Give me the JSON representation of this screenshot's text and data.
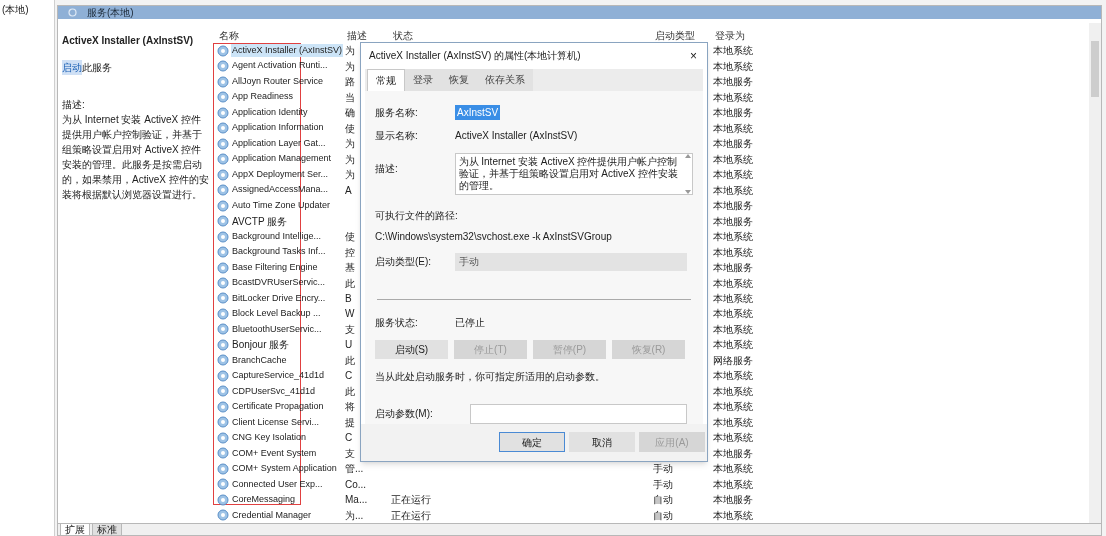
{
  "tree": {
    "label": "(本地)"
  },
  "header": {
    "title": "服务(本地)"
  },
  "detail": {
    "title": "ActiveX Installer (AxInstSV)",
    "action_link": "启动",
    "action_rest": "此服务",
    "description_label": "描述:",
    "description": "为从 Internet 安装 ActiveX 控件提供用户帐户控制验证，并基于组策略设置启用对 ActiveX 控件安装的管理。此服务是按需启动的，如果禁用，ActiveX 控件的安装将根据默认浏览器设置进行。"
  },
  "table": {
    "columns": [
      "名称",
      "描述",
      "状态",
      "启动类型",
      "登录为"
    ],
    "rows": [
      {
        "name": "ActiveX Installer (AxInstSV)",
        "description": "为",
        "logon": "本地系统",
        "selected": true
      },
      {
        "name": "Agent Activation Runti...",
        "description": "为",
        "logon": "本地系统",
        "selected": false
      },
      {
        "name": "AllJoyn Router Service",
        "description": "路",
        "logon": "本地服务",
        "selected": false
      },
      {
        "name": "App Readiness",
        "description": "当",
        "logon": "本地系统",
        "selected": false
      },
      {
        "name": "Application Identity",
        "description": "确",
        "logon": "本地服务",
        "selected": false
      },
      {
        "name": "Application Information",
        "description": "使",
        "logon": "本地系统",
        "selected": false
      },
      {
        "name": "Application Layer Gat...",
        "description": "为",
        "logon": "本地服务",
        "selected": false
      },
      {
        "name": "Application Management",
        "description": "为",
        "logon": "本地系统",
        "selected": false
      },
      {
        "name": "AppX Deployment Ser...",
        "description": "为",
        "logon": "本地系统",
        "selected": false
      },
      {
        "name": "AssignedAccessMana...",
        "description": "A",
        "logon": "本地系统",
        "selected": false
      },
      {
        "name": "Auto Time Zone Updater",
        "logon": "本地服务",
        "selected": false
      },
      {
        "name": "AVCTP 服务",
        "logon": "本地服务",
        "selected": false
      },
      {
        "name": "Background Intellige...",
        "description": "使",
        "logon": "本地系统",
        "selected": false
      },
      {
        "name": "Background Tasks Inf...",
        "description": "控",
        "logon": "本地系统",
        "selected": false
      },
      {
        "name": "Base Filtering Engine",
        "description": "基",
        "logon": "本地服务",
        "selected": false
      },
      {
        "name": "BcastDVRUserServic...",
        "description": "此",
        "logon": "本地系统",
        "selected": false
      },
      {
        "name": "BitLocker Drive Encry...",
        "description": "B",
        "logon": "本地系统",
        "selected": false
      },
      {
        "name": "Block Level Backup ...",
        "description": "W",
        "logon": "本地系统",
        "selected": false
      },
      {
        "name": "BluetoothUserServic...",
        "description": "支",
        "logon": "本地系统",
        "selected": false
      },
      {
        "name": "Bonjour 服务",
        "description": "U",
        "logon": "本地系统",
        "selected": false
      },
      {
        "name": "BranchCache",
        "description": "此",
        "logon": "网络服务",
        "selected": false
      },
      {
        "name": "CaptureService_41d1d",
        "description": "C",
        "logon": "本地系统",
        "selected": false
      },
      {
        "name": "CDPUserSvc_41d1d",
        "description": "此",
        "logon": "本地系统",
        "selected": false
      },
      {
        "name": "Certificate Propagation",
        "description": "将",
        "logon": "本地系统",
        "selected": false
      },
      {
        "name": "Client License Servi...",
        "description": "提",
        "logon": "本地系统",
        "selected": false
      },
      {
        "name": "CNG Key Isolation",
        "description": "C",
        "logon": "本地系统",
        "selected": false
      },
      {
        "name": "COM+ Event System",
        "description": "支",
        "logon": "本地服务",
        "selected": false
      },
      {
        "name": "COM+ System Application",
        "description": "管...",
        "startup": "手动",
        "logon": "本地系统",
        "selected": false
      },
      {
        "name": "Connected User Exp...",
        "description": "Co...",
        "startup": "手动",
        "logon": "本地系统",
        "selected": false
      },
      {
        "name": "CoreMessaging",
        "description": "Ma...",
        "status": "正在运行",
        "startup": "自动",
        "logon": "本地服务",
        "selected": false
      },
      {
        "name": "Credential Manager",
        "description": "为...",
        "status": "正在运行",
        "startup": "自动",
        "logon": "本地系统",
        "selected": false
      }
    ]
  },
  "bottom_tabs": [
    {
      "label": "扩展",
      "selected": true
    },
    {
      "label": "标准",
      "selected": false
    }
  ],
  "dialog": {
    "title": "ActiveX Installer (AxInstSV) 的属性(本地计算机)",
    "close": "×",
    "tabs": [
      {
        "label": "常规",
        "selected": true
      },
      {
        "label": "登录",
        "selected": false
      },
      {
        "label": "恢复",
        "selected": false
      },
      {
        "label": "依存关系",
        "selected": false
      }
    ],
    "service_name_label": "服务名称:",
    "service_name": "AxInstSV",
    "display_name_label": "显示名称:",
    "display_name": "ActiveX Installer (AxInstSV)",
    "description_label": "描述:",
    "description": "为从 Internet 安装 ActiveX 控件提供用户帐户控制验证，并基于组策略设置启用对 ActiveX 控件安装的管理。",
    "path_label": "可执行文件的路径:",
    "path": "C:\\Windows\\system32\\svchost.exe -k AxInstSVGroup",
    "startup_label": "启动类型(E):",
    "startup": "手动",
    "status_label": "服务状态:",
    "status": "已停止",
    "service_buttons": [
      {
        "label": "启动(S)",
        "disabled": false
      },
      {
        "label": "停止(T)",
        "disabled": true
      },
      {
        "label": "暂停(P)",
        "disabled": true
      },
      {
        "label": "恢复(R)",
        "disabled": true
      }
    ],
    "hint": "当从此处启动服务时，你可指定所适用的启动参数。",
    "params_label": "启动参数(M):",
    "buttons": [
      {
        "label": "确定",
        "disabled": false,
        "default": true
      },
      {
        "label": "取消",
        "disabled": false,
        "default": false
      },
      {
        "label": "应用(A)",
        "disabled": true,
        "default": false
      }
    ]
  }
}
